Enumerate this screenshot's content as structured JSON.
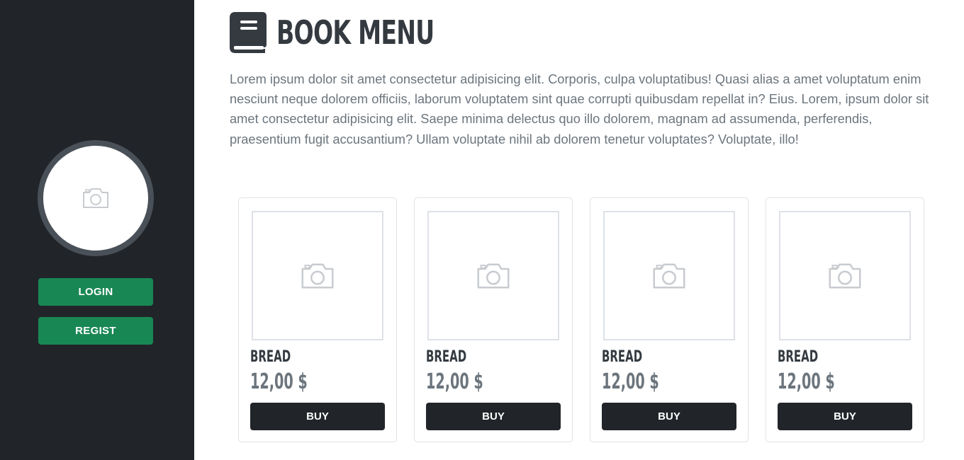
{
  "sidebar": {
    "avatar_icon": "camera-icon",
    "login_label": "LOGIN",
    "regist_label": "REGIST",
    "accent_color": "#198754"
  },
  "header": {
    "icon": "book-icon",
    "title": "BOOK MENU"
  },
  "description": "Lorem ipsum dolor sit amet consectetur adipisicing elit. Corporis, culpa voluptatibus! Quasi alias a amet voluptatum enim nesciunt neque dolorem officiis, laborum voluptatem sint quae corrupti quibusdam repellat in? Eius. Lorem, ipsum dolor sit amet consectetur adipisicing elit. Saepe minima delectus quo illo dolorem, magnam ad assumenda, perferendis, praesentium fugit accusantium? Ullam voluptate nihil ab dolorem tenetur voluptates? Voluptate, illo!",
  "products": [
    {
      "name": "BREAD",
      "price": "12,00 $",
      "button": "BUY",
      "image_icon": "camera-icon"
    },
    {
      "name": "BREAD",
      "price": "12,00 $",
      "button": "BUY",
      "image_icon": "camera-icon"
    },
    {
      "name": "BREAD",
      "price": "12,00 $",
      "button": "BUY",
      "image_icon": "camera-icon"
    },
    {
      "name": "BREAD",
      "price": "12,00 $",
      "button": "BUY",
      "image_icon": "camera-icon"
    }
  ]
}
